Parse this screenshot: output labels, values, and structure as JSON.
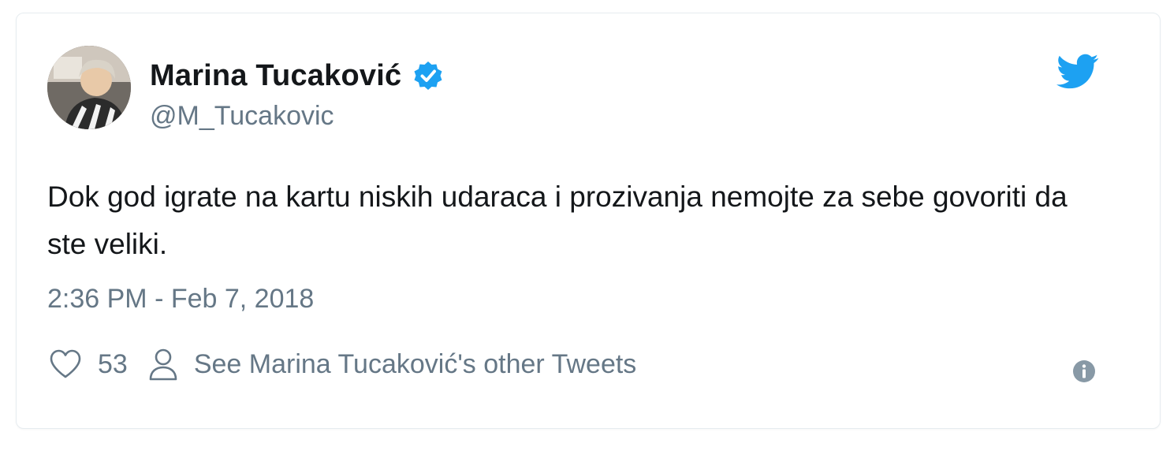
{
  "tweet": {
    "author": {
      "display_name": "Marina Tucaković",
      "handle": "@M_Tucakovic",
      "verified": true
    },
    "text": "Dok god igrate na kartu niskih udaraca i prozivanja nemojte za sebe govoriti da ste veliki.",
    "timestamp": "2:36 PM - Feb 7, 2018",
    "likes": "53",
    "other_tweets_label": "See Marina Tucaković's other Tweets"
  },
  "icons": {
    "verified": "verified-badge-icon",
    "bird": "twitter-bird-icon",
    "heart": "heart-icon",
    "person": "person-icon",
    "info": "info-icon"
  },
  "colors": {
    "brand_blue": "#1da1f2",
    "text_primary": "#14171a",
    "text_secondary": "#657786",
    "border": "#e6ecf0"
  }
}
